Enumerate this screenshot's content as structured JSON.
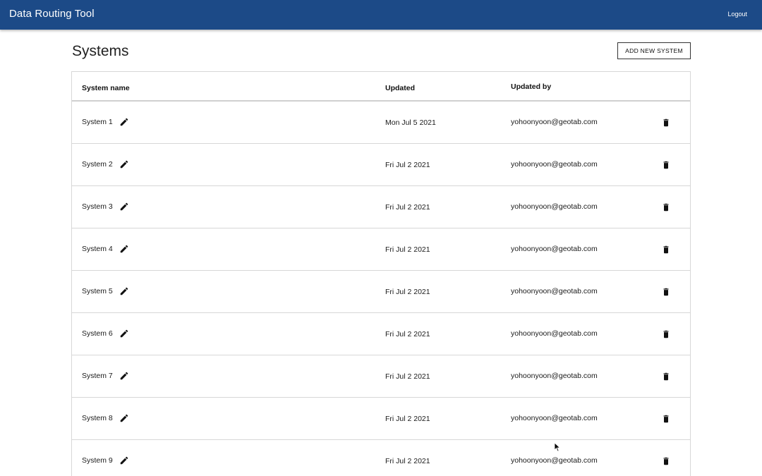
{
  "app": {
    "title": "Data Routing Tool",
    "logout_label": "Logout"
  },
  "page": {
    "title": "Systems",
    "add_button_label": "ADD NEW SYSTEM"
  },
  "table": {
    "headers": {
      "name": "System name",
      "updated": "Updated",
      "updated_by": "Updated by"
    },
    "rows": [
      {
        "name": "System 1",
        "updated": "Mon Jul 5 2021",
        "updated_by": "yohoonyoon@geotab.com"
      },
      {
        "name": "System 2",
        "updated": "Fri Jul 2 2021",
        "updated_by": "yohoonyoon@geotab.com"
      },
      {
        "name": "System 3",
        "updated": "Fri Jul 2 2021",
        "updated_by": "yohoonyoon@geotab.com"
      },
      {
        "name": "System 4",
        "updated": "Fri Jul 2 2021",
        "updated_by": "yohoonyoon@geotab.com"
      },
      {
        "name": "System 5",
        "updated": "Fri Jul 2 2021",
        "updated_by": "yohoonyoon@geotab.com"
      },
      {
        "name": "System 6",
        "updated": "Fri Jul 2 2021",
        "updated_by": "yohoonyoon@geotab.com"
      },
      {
        "name": "System 7",
        "updated": "Fri Jul 2 2021",
        "updated_by": "yohoonyoon@geotab.com"
      },
      {
        "name": "System 8",
        "updated": "Fri Jul 2 2021",
        "updated_by": "yohoonyoon@geotab.com"
      },
      {
        "name": "System 9",
        "updated": "Fri Jul 2 2021",
        "updated_by": "yohoonyoon@geotab.com"
      }
    ],
    "row_icons": {
      "edit": "pencil-icon",
      "delete": "trash-icon"
    }
  },
  "colors": {
    "topbar": "#1c4a87",
    "topbar_text": "#ffffff",
    "border": "#d7d7d7"
  }
}
